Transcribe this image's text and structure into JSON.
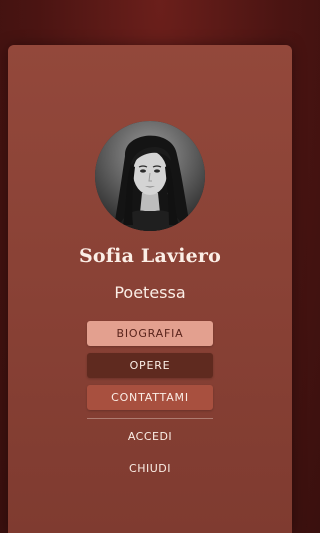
{
  "profile": {
    "name": "Sofia Laviero",
    "role": "Poetessa"
  },
  "menu": {
    "biografia": "BIOGRAFIA",
    "opere": "OPERE",
    "contattami": "CONTATTAMI"
  },
  "footer": {
    "accedi": "ACCEDI",
    "chiudi": "CHIUDI"
  },
  "colors": {
    "background": "#4a1412",
    "card": "#8a4236",
    "active_button": "#e3a08f",
    "dark_button": "#5f2a1f",
    "medium_button": "#a8503f",
    "text": "#fbeee6"
  }
}
